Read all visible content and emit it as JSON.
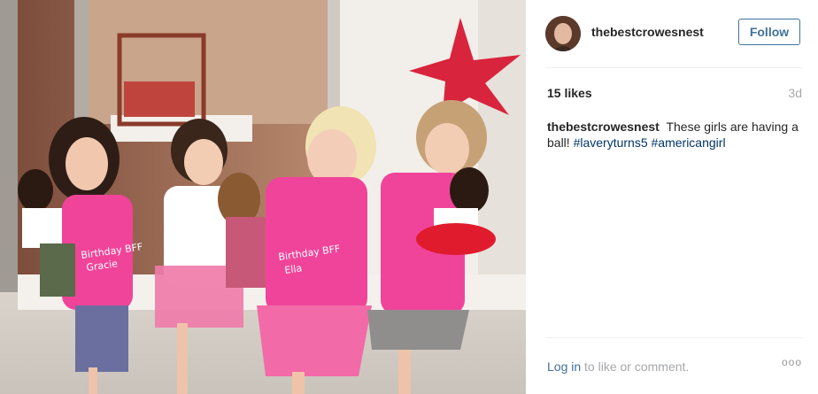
{
  "post": {
    "username": "thebestcrowesnest",
    "follow_label": "Follow",
    "likes": "15 likes",
    "age": "3d",
    "caption_user": "thebestcrowesnest",
    "caption_text": "These girls are having a ball!",
    "hashtags": [
      "#laveryturns5",
      "#americangirl"
    ],
    "login_label": "Log in",
    "login_suffix": "to like or comment.",
    "more_label": "ooo"
  },
  "photo": {
    "shirt_texts": [
      "Birthday BFF",
      "Gracie",
      "Birthday BFF",
      "Ella"
    ]
  },
  "colors": {
    "accent_blue": "#3f729b",
    "hashtag_blue": "#003569",
    "muted_gray": "#a5a7aa",
    "star_red": "#d9243d",
    "shirt_pink": "#f0449a"
  }
}
